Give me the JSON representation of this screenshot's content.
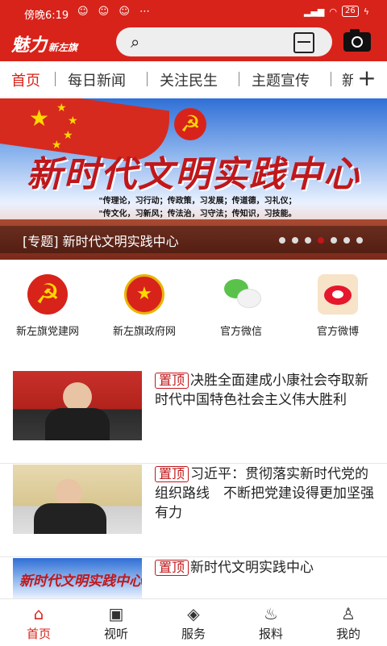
{
  "status": {
    "time": "傍晚6:19",
    "battery": "26"
  },
  "header": {
    "logo_main": "魅力",
    "logo_sub": "新左旗",
    "search_placeholder": ""
  },
  "tabs": [
    "首页",
    "每日新闻",
    "关注民生",
    "主题宣传",
    "新"
  ],
  "banner": {
    "title": "新时代文明实践中心",
    "line1": "\"传理论，习行动；传政策，习发展；传道德，习礼仪；",
    "line2": "\"传文化，习新风；传法治，习守法；传知识，习技能。",
    "caption": "[专题] 新时代文明实践中心",
    "dots": 7,
    "active_dot": 3
  },
  "quick": [
    {
      "label": "新左旗党建网",
      "icon": "party-emblem-icon"
    },
    {
      "label": "新左旗政府网",
      "icon": "national-emblem-icon"
    },
    {
      "label": "官方微信",
      "icon": "wechat-icon"
    },
    {
      "label": "官方微博",
      "icon": "weibo-icon"
    }
  ],
  "news": [
    {
      "tag": "置顶",
      "title": "决胜全面建成小康社会夺取新时代中国特色社会主义伟大胜利"
    },
    {
      "tag": "置顶",
      "title": "习近平：贯彻落实新时代党的组织路线　不断把党建设得更加坚强有力"
    },
    {
      "tag": "置顶",
      "title": "新时代文明实践中心"
    }
  ],
  "bottom_nav": [
    "首页",
    "视听",
    "服务",
    "报料",
    "我的"
  ],
  "colors": {
    "accent": "#d8231a"
  }
}
